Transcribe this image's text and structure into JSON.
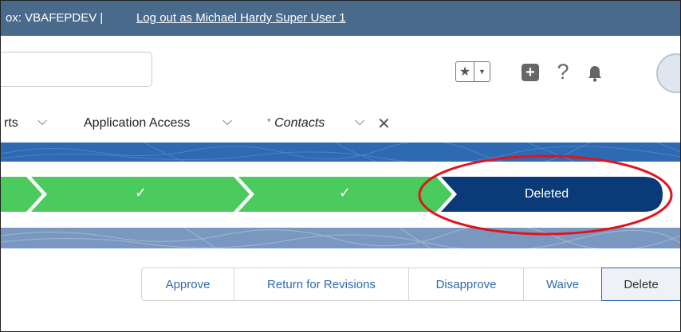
{
  "banner": {
    "env_label": "ox: VBAFEPDEV |",
    "logout_link": "Log out as Michael Hardy Super User 1"
  },
  "header": {
    "search": {
      "placeholder": ""
    },
    "icons": [
      "star-icon",
      "chevron-down-icon",
      "plus-icon",
      "help-icon",
      "bell-icon",
      "avatar"
    ]
  },
  "nav": {
    "tabs": [
      {
        "label": "rts"
      },
      {
        "label": "Application Access"
      },
      {
        "label": "Contacts",
        "unsaved_marker": "*"
      }
    ]
  },
  "path": {
    "stages": [
      {
        "label": "",
        "status": "complete"
      },
      {
        "label": "✓",
        "status": "complete"
      },
      {
        "label": "✓",
        "status": "complete"
      },
      {
        "label": "Deleted",
        "status": "current"
      }
    ]
  },
  "actions": {
    "approve": "Approve",
    "return_for_revisions": "Return for Revisions",
    "disapprove": "Disapprove",
    "waive": "Waive",
    "delete": "Delete"
  },
  "colors": {
    "banner": "#4a6a8c",
    "complete_stage": "#4bca5d",
    "current_stage": "#0b3a78",
    "annotation": "#e0141e",
    "link_blue": "#2e6ab1"
  }
}
